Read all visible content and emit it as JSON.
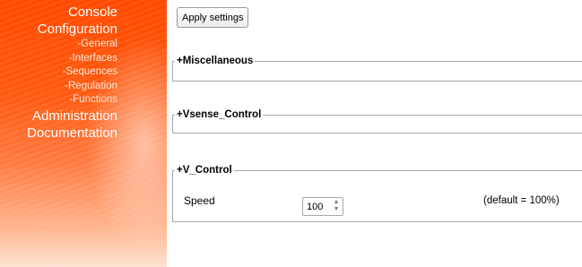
{
  "sidebar": {
    "items": [
      {
        "label": "Console",
        "level": 1
      },
      {
        "label": "Configuration",
        "level": 1
      },
      {
        "label": "-General",
        "level": 2
      },
      {
        "label": "-Interfaces",
        "level": 2
      },
      {
        "label": "-Sequences",
        "level": 2
      },
      {
        "label": "-Regulation",
        "level": 2
      },
      {
        "label": "-Functions",
        "level": 2
      },
      {
        "label": "Administration",
        "level": 1
      },
      {
        "label": "Documentation",
        "level": 1
      }
    ]
  },
  "toolbar": {
    "apply_label": "Apply settings"
  },
  "sections": {
    "misc": {
      "title": "+Miscellaneous"
    },
    "vsense": {
      "title": "+Vsense_Control"
    },
    "vcontrol": {
      "title": "+V_Control",
      "speed_label": "Speed",
      "speed_value": "100",
      "speed_default": "(default = 100%)"
    }
  },
  "colors": {
    "sidebar_top": "#ff4a00",
    "sidebar_bottom": "#ffe2d2",
    "nav_text": "#ffffff",
    "fieldset_border": "#a8a8a8"
  }
}
